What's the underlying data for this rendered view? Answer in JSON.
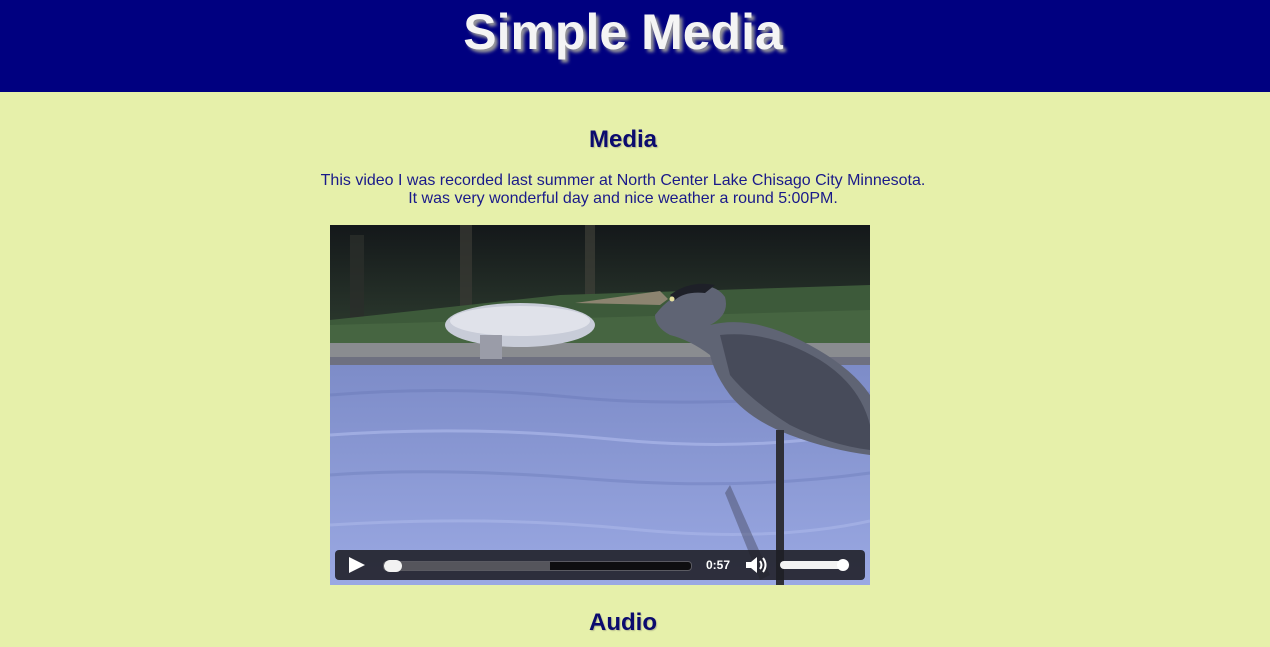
{
  "header": {
    "title": "Simple Media",
    "background_color": "#000080"
  },
  "media_section": {
    "heading": "Media",
    "description_lines": [
      "This video I was recorded last summer at North Center Lake Chisago City Minnesota.",
      "It was very wonderful day and nice weather a round 5:00PM."
    ]
  },
  "video_player": {
    "controls": {
      "play_icon": "play-icon",
      "time": "0:57",
      "volume_icon": "volume-icon",
      "progress_fraction": 0.0,
      "buffered_fraction": 0.54,
      "volume_fraction": 0.9
    }
  },
  "audio_section": {
    "heading": "Audio"
  },
  "colors": {
    "page_background": "#e6f0aa",
    "heading_text": "#0b0b6e"
  }
}
